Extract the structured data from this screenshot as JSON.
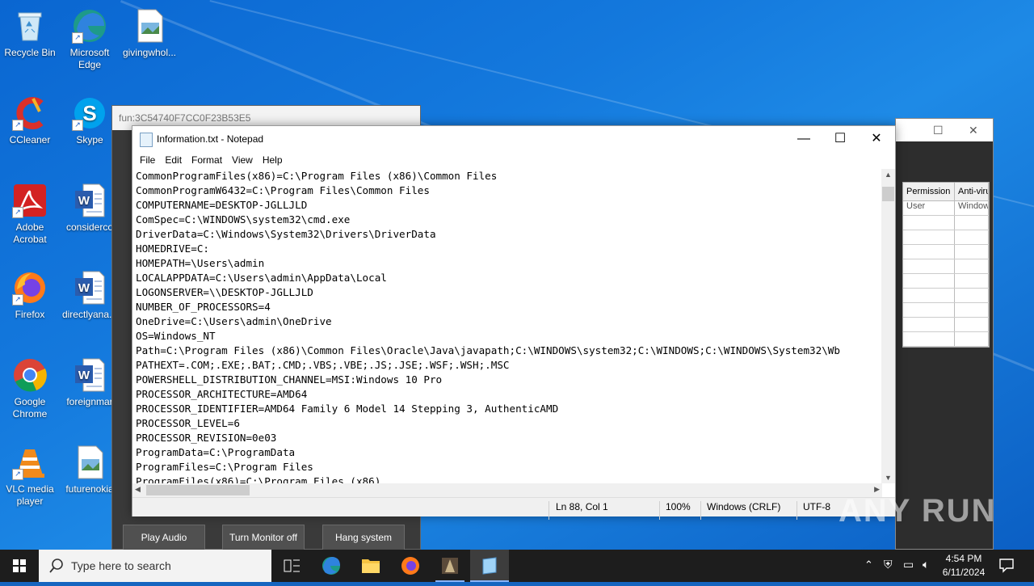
{
  "desktop": {
    "icons": [
      {
        "label": "Recycle Bin"
      },
      {
        "label": "Microsoft Edge"
      },
      {
        "label": "givingwhol..."
      },
      {
        "label": "CCleaner"
      },
      {
        "label": "Skype"
      },
      {
        "label": "Adobe Acrobat"
      },
      {
        "label": "considerco"
      },
      {
        "label": "Firefox"
      },
      {
        "label": "directlyana..."
      },
      {
        "label": "Google Chrome"
      },
      {
        "label": "foreignmar"
      },
      {
        "label": "VLC media player"
      },
      {
        "label": "futurenokia"
      }
    ]
  },
  "tool_window": {
    "title": "fun:3C54740F7CC0F23B53E5",
    "buttons": [
      "Play Audio",
      "Turn Monitor off",
      "Hang system"
    ]
  },
  "grid_window": {
    "columns": [
      "Permission",
      "Anti-viru"
    ],
    "first_row": [
      "User",
      "Window"
    ]
  },
  "notepad": {
    "title": "Information.txt - Notepad",
    "menu": [
      "File",
      "Edit",
      "Format",
      "View",
      "Help"
    ],
    "lines": [
      "CommonProgramFiles(x86)=C:\\Program Files (x86)\\Common Files",
      "CommonProgramW6432=C:\\Program Files\\Common Files",
      "COMPUTERNAME=DESKTOP-JGLLJLD",
      "ComSpec=C:\\WINDOWS\\system32\\cmd.exe",
      "DriverData=C:\\Windows\\System32\\Drivers\\DriverData",
      "HOMEDRIVE=C:",
      "HOMEPATH=\\Users\\admin",
      "LOCALAPPDATA=C:\\Users\\admin\\AppData\\Local",
      "LOGONSERVER=\\\\DESKTOP-JGLLJLD",
      "NUMBER_OF_PROCESSORS=4",
      "OneDrive=C:\\Users\\admin\\OneDrive",
      "OS=Windows_NT",
      "Path=C:\\Program Files (x86)\\Common Files\\Oracle\\Java\\javapath;C:\\WINDOWS\\system32;C:\\WINDOWS;C:\\WINDOWS\\System32\\Wb",
      "PATHEXT=.COM;.EXE;.BAT;.CMD;.VBS;.VBE;.JS;.JSE;.WSF;.WSH;.MSC",
      "POWERSHELL_DISTRIBUTION_CHANNEL=MSI:Windows 10 Pro",
      "PROCESSOR_ARCHITECTURE=AMD64",
      "PROCESSOR_IDENTIFIER=AMD64 Family 6 Model 14 Stepping 3, AuthenticAMD",
      "PROCESSOR_LEVEL=6",
      "PROCESSOR_REVISION=0e03",
      "ProgramData=C:\\ProgramData",
      "ProgramFiles=C:\\Program Files",
      "ProgramFiles(x86)=C:\\Program Files (x86)"
    ],
    "status": {
      "position": "Ln 88, Col 1",
      "zoom": "100%",
      "line_ending": "Windows (CRLF)",
      "encoding": "UTF-8"
    }
  },
  "taskbar": {
    "search_placeholder": "Type here to search",
    "time": "4:54 PM",
    "date": "6/11/2024"
  },
  "watermark": "ANY RUN"
}
